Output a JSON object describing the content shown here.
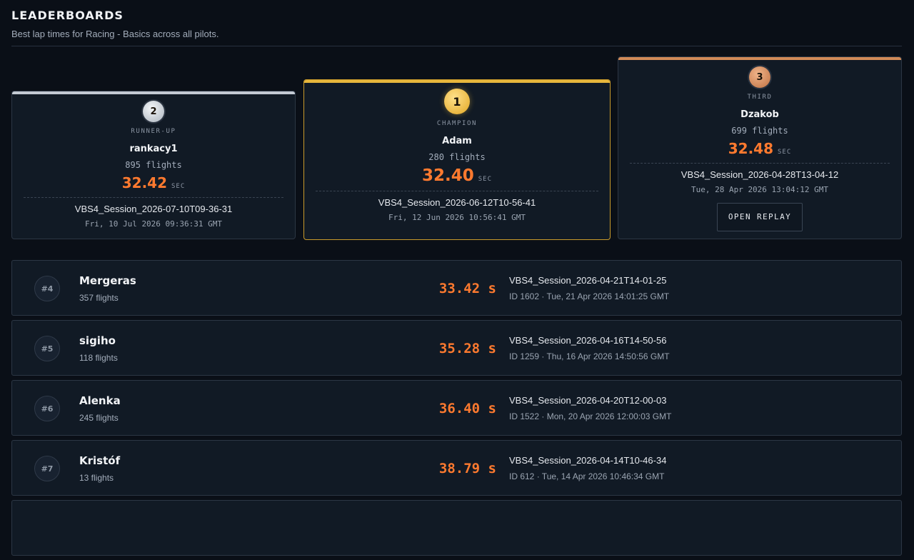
{
  "header": {
    "title": "LEADERBOARDS",
    "subtitle": "Best lap times for Racing - Basics across all pilots."
  },
  "podium": [
    {
      "rank": "2",
      "label": "RUNNER-UP",
      "name": "rankacy1",
      "flights": "895 flights",
      "time": "32.42",
      "unit": "SEC",
      "session": "VBS4_Session_2026-07-10T09-36-31",
      "date": "Fri, 10 Jul 2026 09:36:31 GMT"
    },
    {
      "rank": "1",
      "label": "CHAMPION",
      "name": "Adam",
      "flights": "280 flights",
      "time": "32.40",
      "unit": "SEC",
      "session": "VBS4_Session_2026-06-12T10-56-41",
      "date": "Fri, 12 Jun 2026 10:56:41 GMT"
    },
    {
      "rank": "3",
      "label": "THIRD",
      "name": "Dzakob",
      "flights": "699 flights",
      "time": "32.48",
      "unit": "SEC",
      "session": "VBS4_Session_2026-04-28T13-04-12",
      "date": "Tue, 28 Apr 2026 13:04:12 GMT",
      "replay_label": "OPEN REPLAY"
    }
  ],
  "rows": [
    {
      "rank": "#4",
      "name": "Mergeras",
      "flights": "357 flights",
      "time": "33.42 s",
      "session": "VBS4_Session_2026-04-21T14-01-25",
      "meta": "ID 1602 · Tue, 21 Apr 2026 14:01:25 GMT"
    },
    {
      "rank": "#5",
      "name": "sigiho",
      "flights": "118 flights",
      "time": "35.28 s",
      "session": "VBS4_Session_2026-04-16T14-50-56",
      "meta": "ID 1259 · Thu, 16 Apr 2026 14:50:56 GMT"
    },
    {
      "rank": "#6",
      "name": "Alenka",
      "flights": "245 flights",
      "time": "36.40 s",
      "session": "VBS4_Session_2026-04-20T12-00-03",
      "meta": "ID 1522 · Mon, 20 Apr 2026 12:00:03 GMT"
    },
    {
      "rank": "#7",
      "name": "Kristóf",
      "flights": "13 flights",
      "time": "38.79 s",
      "session": "VBS4_Session_2026-04-14T10-46-34",
      "meta": "ID 612 · Tue, 14 Apr 2026 10:46:34 GMT"
    }
  ],
  "colors": {
    "accent": "#ff7a2f",
    "gold": "#e7b73c",
    "silver": "#c3cad3",
    "bronze": "#d18a57",
    "background": "#0a0f17",
    "card": "#111a25"
  }
}
